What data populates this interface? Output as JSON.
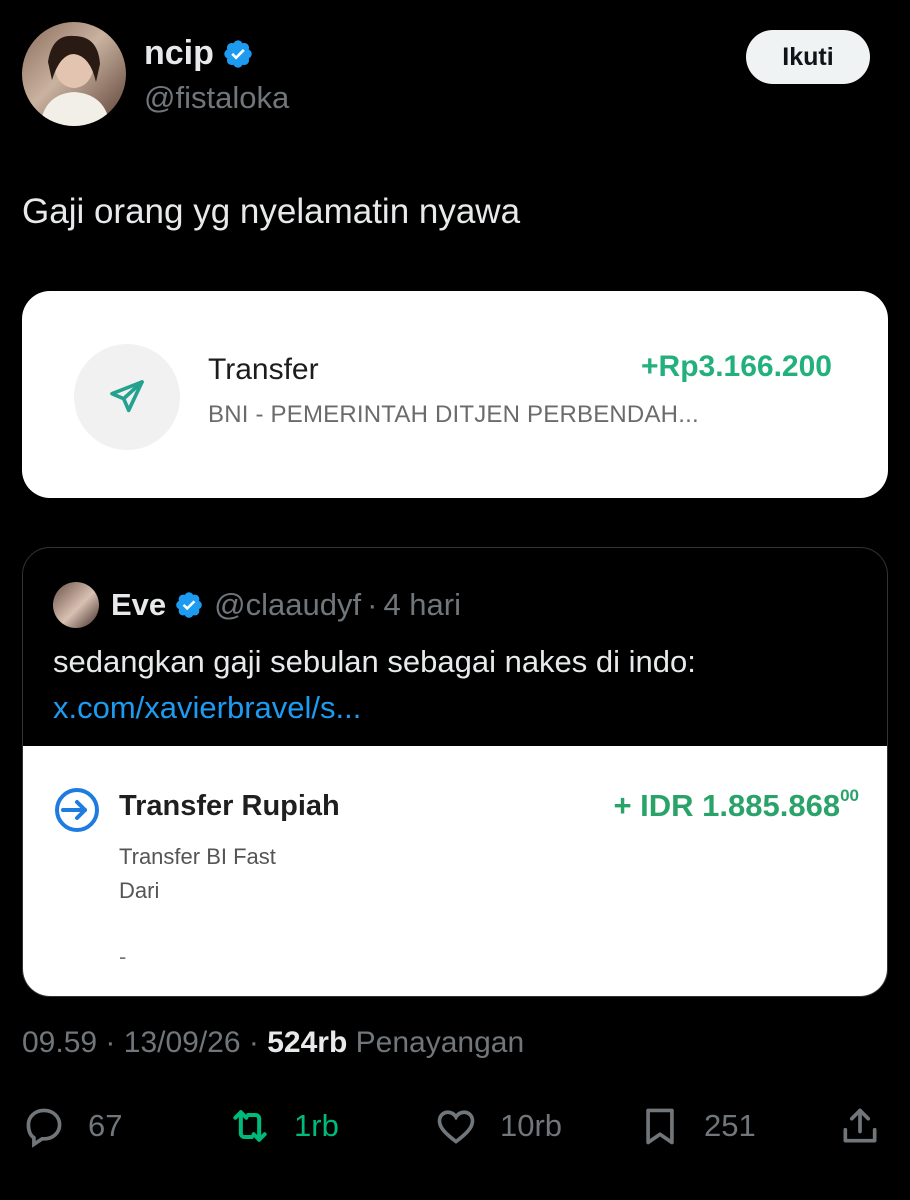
{
  "author": {
    "name": "ncip",
    "handle": "@fistaloka",
    "verified": true,
    "follow_label": "Ikuti"
  },
  "tweet": {
    "text": "Gaji orang yg nyelamatin nyawa"
  },
  "transfer_card": {
    "icon": "send-icon",
    "title": "Transfer",
    "subtitle": "BNI - PEMERINTAH DITJEN PERBENDAH...",
    "amount": "+Rp3.166.200",
    "amount_color": "#22b07d"
  },
  "quoted_tweet": {
    "name": "Eve",
    "handle": "@claaudyf",
    "separator": "·",
    "time": "4 hari",
    "text": "sedangkan gaji sebulan sebagai nakes di indo:",
    "link": "x.com/xavierbravel/s...",
    "media": {
      "icon": "transfer-in-icon",
      "title": "Transfer Rupiah",
      "amount": "+ IDR 1.885.868",
      "amount_cents": "00",
      "line1": "Transfer BI Fast",
      "line2": "Dari",
      "line3": "-"
    }
  },
  "meta": {
    "time": "09.59",
    "sep1": "·",
    "date": "13/09/26",
    "sep2": "·",
    "views": "524rb",
    "views_label": "Penayangan"
  },
  "actions": {
    "replies": "67",
    "reposts": "1rb",
    "likes": "10rb",
    "bookmarks": "251"
  },
  "colors": {
    "background": "#000000",
    "verified_blue": "#1d9bf0",
    "link_blue": "#1d9bf0",
    "repost_green": "#00ba7c",
    "muted": "#71767b"
  }
}
